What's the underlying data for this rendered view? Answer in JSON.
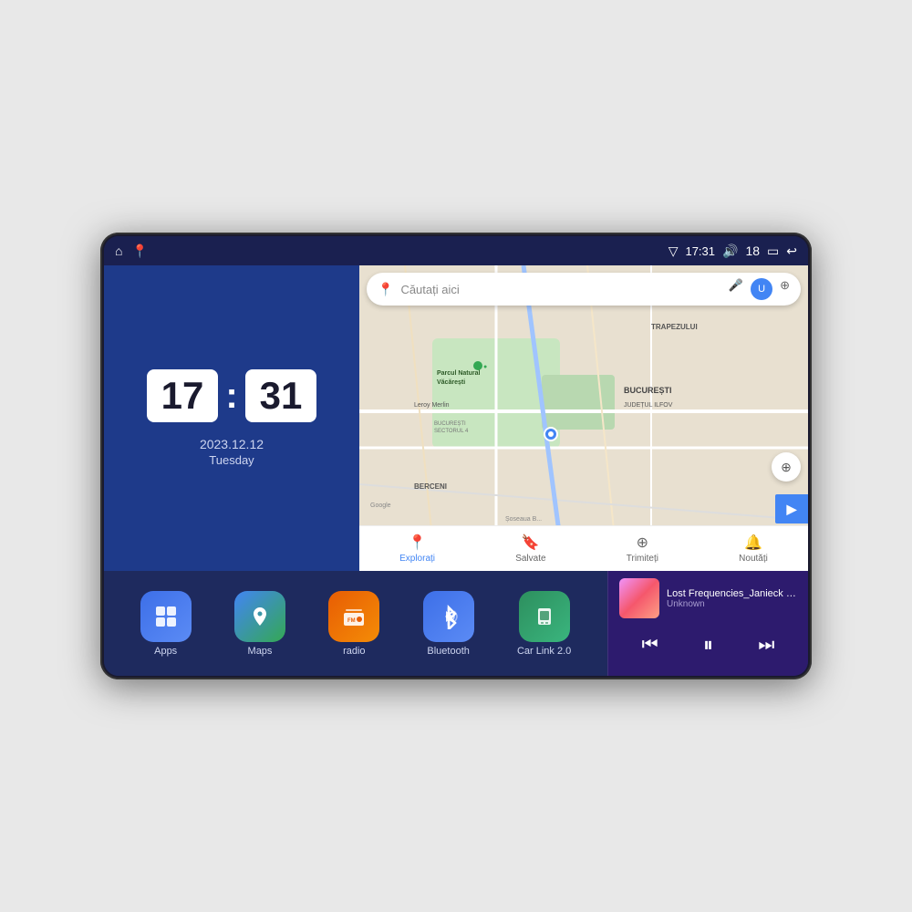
{
  "device": {
    "status_bar": {
      "location_icon": "▽",
      "time": "17:31",
      "volume_icon": "🔊",
      "volume_level": "18",
      "battery_icon": "▭",
      "back_icon": "↩"
    },
    "home_icon": "⌂",
    "map_icon": "📍"
  },
  "clock": {
    "hours": "17",
    "minutes": "31",
    "date": "2023.12.12",
    "day": "Tuesday"
  },
  "map": {
    "search_placeholder": "Căutați aici",
    "bottom_tabs": [
      {
        "label": "Explorați",
        "icon": "📍"
      },
      {
        "label": "Salvate",
        "icon": "🔖"
      },
      {
        "label": "Trimiteți",
        "icon": "⊕"
      },
      {
        "label": "Noutăți",
        "icon": "🔔"
      }
    ],
    "labels": [
      "TRAPEZULUI",
      "BUCUREȘTI",
      "JUDEȚUL ILFOV",
      "BERCENI",
      "Parcul Natural Văcărești",
      "Leroy Merlin",
      "BUCUREȘTI SECTORUL 4",
      "Google",
      "Soseaua B..."
    ]
  },
  "apps": [
    {
      "id": "apps",
      "label": "Apps",
      "icon": "⊞",
      "color_class": "apps-bg"
    },
    {
      "id": "maps",
      "label": "Maps",
      "icon": "🗺",
      "color_class": "maps-bg"
    },
    {
      "id": "radio",
      "label": "radio",
      "icon": "📻",
      "color_class": "radio-bg"
    },
    {
      "id": "bluetooth",
      "label": "Bluetooth",
      "icon": "⚡",
      "color_class": "bt-bg"
    },
    {
      "id": "carlink",
      "label": "Car Link 2.0",
      "icon": "📱",
      "color_class": "carlink-bg"
    }
  ],
  "music": {
    "title": "Lost Frequencies_Janieck Devy-...",
    "artist": "Unknown",
    "prev_icon": "⏮",
    "play_icon": "⏸",
    "next_icon": "⏭"
  }
}
